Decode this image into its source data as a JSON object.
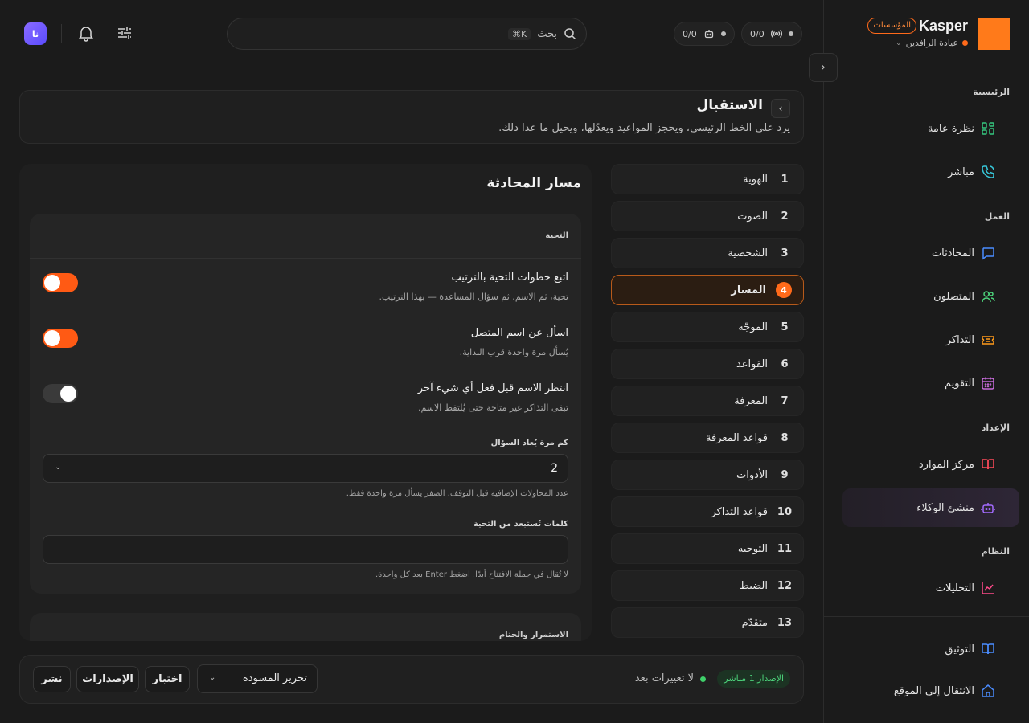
{
  "brand": {
    "name": "Kasper",
    "badge": "المؤسسات",
    "org": "عيادة الرافدين",
    "logo_color": "#ff7a1a"
  },
  "sidebar": {
    "sections": {
      "home": "الرئيسية",
      "work": "العمل",
      "setup": "الإعداد",
      "system": "النظام"
    },
    "items": [
      {
        "label": "نظرة عامة",
        "icon": "grid-icon",
        "color": "#35c77f"
      },
      {
        "label": "مباشر",
        "icon": "phone-icon",
        "color": "#37c7d9"
      },
      {
        "label": "المحادثات",
        "icon": "chat-icon",
        "color": "#4a8cff"
      },
      {
        "label": "المتصلون",
        "icon": "users-icon",
        "color": "#4cd17a"
      },
      {
        "label": "التذاكر",
        "icon": "ticket-icon",
        "color": "#ff9a1a"
      },
      {
        "label": "التقويم",
        "icon": "calendar-icon",
        "color": "#c66bd9"
      },
      {
        "label": "مركز الموارد",
        "icon": "book-icon",
        "color": "#ff4a5a"
      },
      {
        "label": "منشئ الوكلاء",
        "icon": "bot-icon",
        "color": "#a36bff",
        "active": true
      },
      {
        "label": "التحليلات",
        "icon": "chart-icon",
        "color": "#ff4a8a"
      }
    ],
    "footer": [
      {
        "label": "التوثيق",
        "icon": "docs-icon",
        "color": "#4a8cff"
      },
      {
        "label": "الانتقال إلى الموقع",
        "icon": "home-icon",
        "color": "#4a8cff"
      }
    ]
  },
  "topbar": {
    "counter1": "0/0",
    "counter2": "0/0",
    "search_placeholder": "بحث",
    "shortcut": "⌘K",
    "avatar": "نا"
  },
  "header": {
    "title": "الاستقبال",
    "description": "يرد على الخط الرئيسي، ويحجز المواعيد ويعدّلها، ويحيل ما عدا ذلك."
  },
  "steps": [
    {
      "num": "1",
      "label": "الهوية"
    },
    {
      "num": "2",
      "label": "الصوت"
    },
    {
      "num": "3",
      "label": "الشخصية"
    },
    {
      "num": "4",
      "label": "المسار",
      "active": true
    },
    {
      "num": "5",
      "label": "الموجّه"
    },
    {
      "num": "6",
      "label": "القواعد"
    },
    {
      "num": "7",
      "label": "المعرفة"
    },
    {
      "num": "8",
      "label": "قواعد المعرفة"
    },
    {
      "num": "9",
      "label": "الأدوات"
    },
    {
      "num": "10",
      "label": "قواعد التذاكر"
    },
    {
      "num": "11",
      "label": "التوجيه"
    },
    {
      "num": "12",
      "label": "الضبط"
    },
    {
      "num": "13",
      "label": "متقدّم"
    }
  ],
  "panel": {
    "title": "مسار المحادثة",
    "greeting": {
      "heading": "التحية",
      "toggles": [
        {
          "label": "اتبع خطوات التحية بالترتيب",
          "desc": "تحية، ثم الاسم، ثم سؤال المساعدة — بهذا الترتيب.",
          "on": true
        },
        {
          "label": "اسأل عن اسم المتصل",
          "desc": "يُسأل مرة واحدة قرب البداية.",
          "on": true
        },
        {
          "label": "انتظر الاسم قبل فعل أي شيء آخر",
          "desc": "تبقى التذاكر غير متاحة حتى يُلتقط الاسم.",
          "on": false
        }
      ],
      "retries_label": "كم مرة يُعاد السؤال",
      "retries_value": "2",
      "retries_hint": "عدد المحاولات الإضافية قبل التوقف. الصفر يسأل مرة واحدة فقط.",
      "excluded_label": "كلمات تُستبعد من التحية",
      "excluded_value": "",
      "excluded_hint": "لا تُقال في جملة الافتتاح أبدًا. اضغط Enter بعد كل واحدة."
    },
    "closing_heading": "الاستمرار والختام"
  },
  "actionbar": {
    "live_badge": "الإصدار 1 مباشر",
    "status": "لا تغييرات بعد",
    "mode": "تحرير المسودة",
    "test": "اختبار",
    "versions": "الإصدارات",
    "publish": "نشر"
  }
}
